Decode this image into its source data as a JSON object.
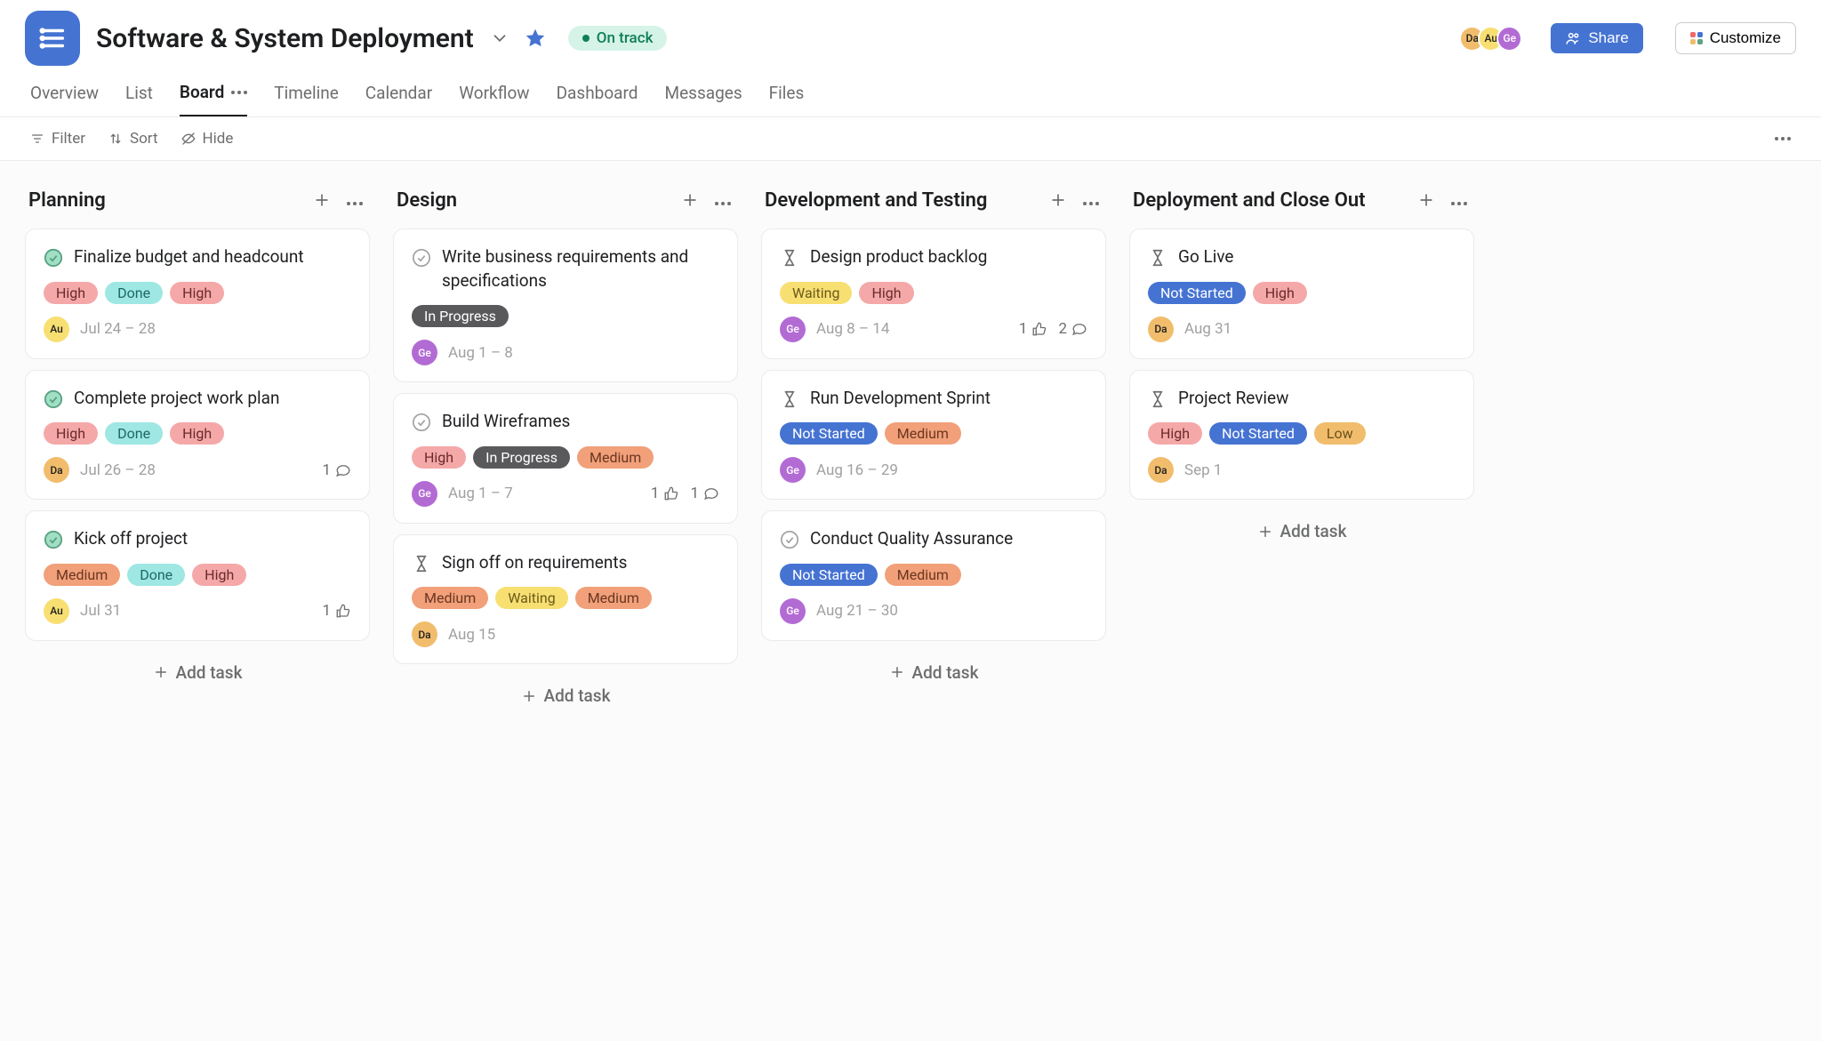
{
  "project": {
    "title": "Software & System Deployment",
    "status": "On track"
  },
  "header": {
    "avatars": [
      "Da",
      "Au",
      "Ge"
    ],
    "share_label": "Share",
    "customize_label": "Customize"
  },
  "tabs": [
    {
      "label": "Overview",
      "active": false
    },
    {
      "label": "List",
      "active": false
    },
    {
      "label": "Board",
      "active": true,
      "more": true
    },
    {
      "label": "Timeline",
      "active": false
    },
    {
      "label": "Calendar",
      "active": false
    },
    {
      "label": "Workflow",
      "active": false
    },
    {
      "label": "Dashboard",
      "active": false
    },
    {
      "label": "Messages",
      "active": false
    },
    {
      "label": "Files",
      "active": false
    }
  ],
  "toolbar": {
    "filter": "Filter",
    "sort": "Sort",
    "hide": "Hide"
  },
  "add_task_label": "Add task",
  "columns": [
    {
      "title": "Planning",
      "cards": [
        {
          "icon": "complete",
          "title": "Finalize budget and headcount",
          "tags": [
            "High",
            "Done",
            "High"
          ],
          "assignee": "Au",
          "date": "Jul 24 – 28"
        },
        {
          "icon": "complete",
          "title": "Complete project work plan",
          "tags": [
            "High",
            "Done",
            "High"
          ],
          "assignee": "Da",
          "date": "Jul 26 – 28",
          "comments": 1
        },
        {
          "icon": "complete",
          "title": "Kick off project",
          "tags": [
            "Medium",
            "Done",
            "High"
          ],
          "assignee": "Au",
          "date": "Jul 31",
          "likes": 1
        }
      ]
    },
    {
      "title": "Design",
      "cards": [
        {
          "icon": "circle",
          "title": "Write business requirements and specifications",
          "tags": [
            "In Progress"
          ],
          "assignee": "Ge",
          "date": "Aug 1 – 8"
        },
        {
          "icon": "circle",
          "title": "Build Wireframes",
          "tags": [
            "High",
            "In Progress",
            "Medium"
          ],
          "assignee": "Ge",
          "date": "Aug 1 – 7",
          "likes": 1,
          "comments": 1
        },
        {
          "icon": "hourglass",
          "title": "Sign off on requirements",
          "tags": [
            "Medium",
            "Waiting",
            "Medium"
          ],
          "assignee": "Da",
          "date": "Aug 15"
        }
      ]
    },
    {
      "title": "Development and Testing",
      "cards": [
        {
          "icon": "hourglass",
          "title": "Design product backlog",
          "tags": [
            "Waiting",
            "High"
          ],
          "assignee": "Ge",
          "date": "Aug 8 – 14",
          "likes": 1,
          "comments": 2
        },
        {
          "icon": "hourglass",
          "title": "Run Development Sprint",
          "tags": [
            "Not Started",
            "Medium"
          ],
          "assignee": "Ge",
          "date": "Aug 16 – 29"
        },
        {
          "icon": "circle",
          "title": "Conduct Quality Assurance",
          "tags": [
            "Not Started",
            "Medium"
          ],
          "assignee": "Ge",
          "date": "Aug 21 – 30"
        }
      ]
    },
    {
      "title": "Deployment and Close Out",
      "cards": [
        {
          "icon": "hourglass",
          "title": "Go Live",
          "tags": [
            "Not Started",
            "High"
          ],
          "assignee": "Da",
          "date": "Aug 31"
        },
        {
          "icon": "hourglass",
          "title": "Project Review",
          "tags": [
            "High",
            "Not Started",
            "Low"
          ],
          "assignee": "Da",
          "date": "Sep 1"
        }
      ]
    }
  ]
}
